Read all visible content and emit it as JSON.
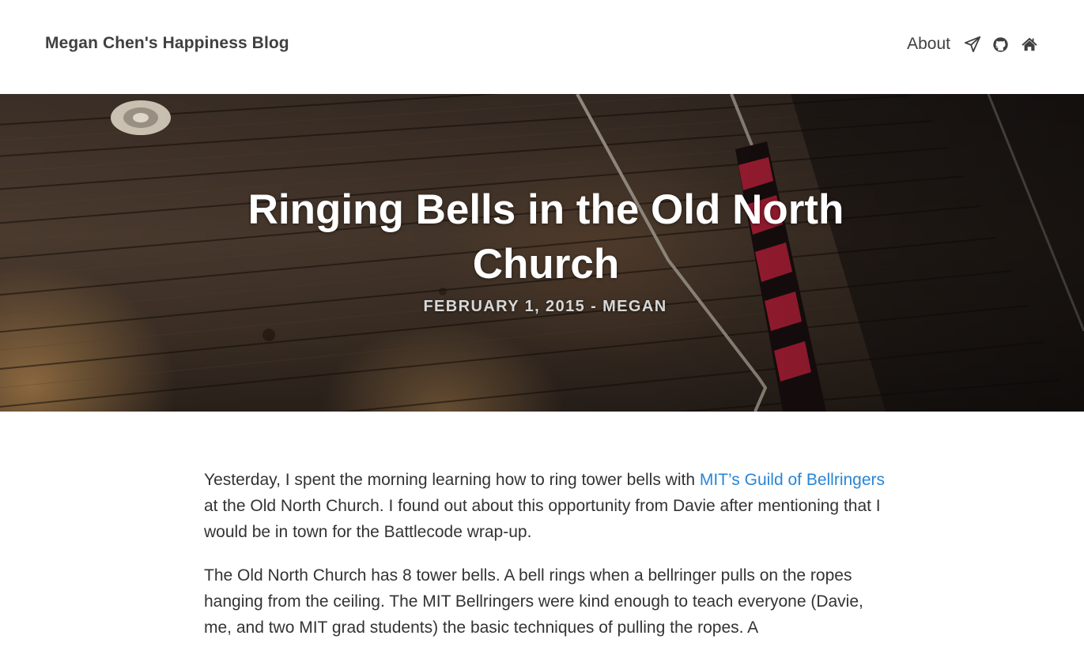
{
  "navbar": {
    "brand": "Megan Chen's Happiness Blog",
    "links": [
      {
        "label": "About"
      }
    ],
    "icons": [
      "paper-plane-icon",
      "github-icon",
      "home-icon"
    ]
  },
  "header": {
    "title": "Ringing Bells in the Old North Church",
    "meta": "FEBRUARY 1, 2015 - MEGAN"
  },
  "article": {
    "p1_before": "Yesterday, I spent the morning learning how to ring tower bells with ",
    "p1_link": "MIT’s Guild of Bellringers",
    "p1_after": " at the Old North Church. I found out about this opportunity from Davie after mentioning that I would be in town for the Battlecode wrap-up.",
    "p2": "The Old North Church has 8 tower bells. A bell rings when a bellringer pulls on the ropes hanging from the ceiling. The MIT Bellringers were kind enough to teach everyone (Davie, me, and two MIT grad students) the basic techniques of pulling the ropes. A"
  },
  "colors": {
    "link": "#2a85d6",
    "text": "#333333",
    "nav_text": "#404040"
  }
}
